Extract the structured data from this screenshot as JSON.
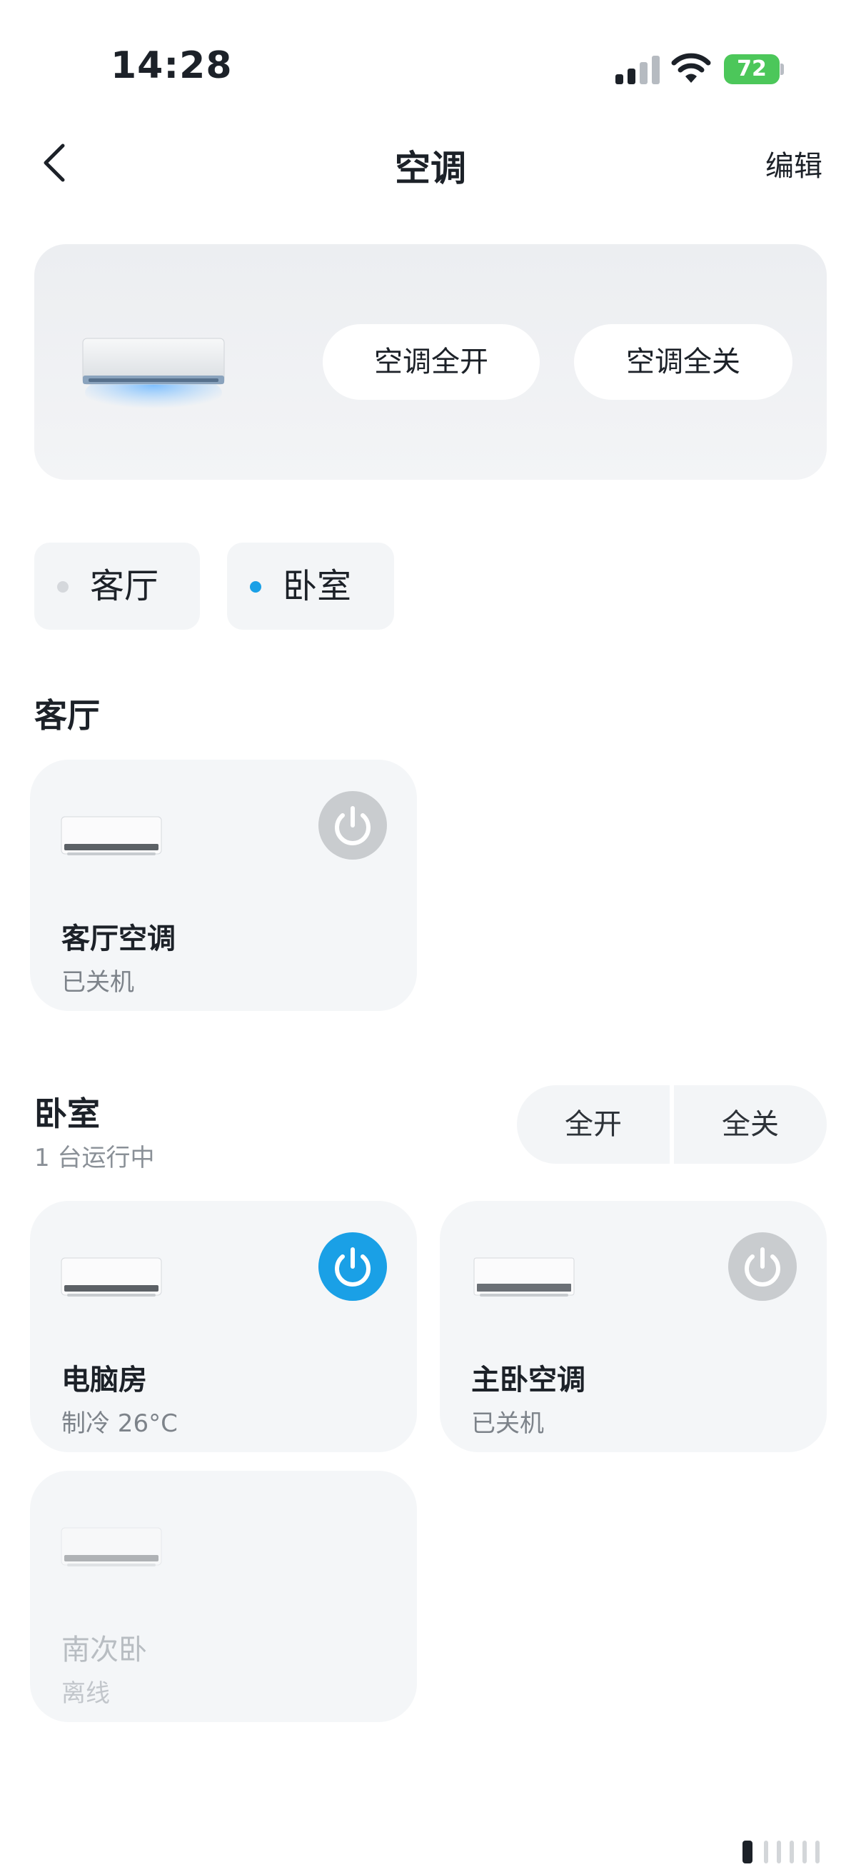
{
  "status_bar": {
    "time": "14:28",
    "battery": "72"
  },
  "nav": {
    "title": "空调",
    "edit": "编辑"
  },
  "hero": {
    "all_on": "空调全开",
    "all_off": "空调全关"
  },
  "room_chips": [
    {
      "label": "客厅",
      "dot_color": "#d5d8dc"
    },
    {
      "label": "卧室",
      "dot_color": "#1aa0e6"
    }
  ],
  "sections": {
    "living": {
      "title": "客厅",
      "devices": [
        {
          "name": "客厅空调",
          "state": "已关机",
          "power": "off"
        }
      ]
    },
    "bedroom": {
      "title": "卧室",
      "subtitle": "1 台运行中",
      "all_on": "全开",
      "all_off": "全关",
      "devices": [
        {
          "name": "电脑房",
          "state": "制冷 26°C",
          "power": "on"
        },
        {
          "name": "主卧空调",
          "state": "已关机",
          "power": "off"
        },
        {
          "name": "南次卧",
          "state": "离线",
          "power": "offline"
        }
      ]
    }
  },
  "colors": {
    "accent": "#1aa0e6",
    "power_off": "#c9cccf",
    "card_bg": "#f4f6f8"
  },
  "icons": [
    "back-chevron-icon",
    "power-icon",
    "air-conditioner-icon",
    "signal-icon",
    "wifi-icon",
    "battery-icon"
  ]
}
